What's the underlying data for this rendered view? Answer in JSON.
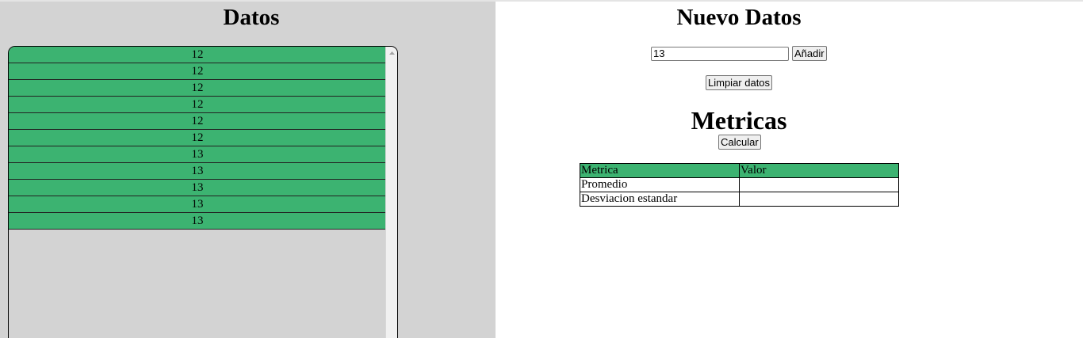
{
  "datos_panel": {
    "title": "Datos",
    "rows": [
      "12",
      "12",
      "12",
      "12",
      "12",
      "12",
      "13",
      "13",
      "13",
      "13",
      "13"
    ]
  },
  "nuevo_panel": {
    "title": "Nuevo Datos",
    "input_value": "13",
    "add_label": "Añadir",
    "clear_label": "Limpiar datos"
  },
  "metricas_panel": {
    "title": "Metricas",
    "calc_label": "Calcular",
    "headers": [
      "Metrica",
      "Valor"
    ],
    "rows": [
      {
        "metric": "Promedio",
        "value": ""
      },
      {
        "metric": "Desviacion estandar",
        "value": ""
      }
    ]
  },
  "colors": {
    "left_bg": "#d3d3d3",
    "row_green": "#3cb371"
  },
  "icons": {
    "scroll_up": "scroll-up-arrow-icon"
  }
}
